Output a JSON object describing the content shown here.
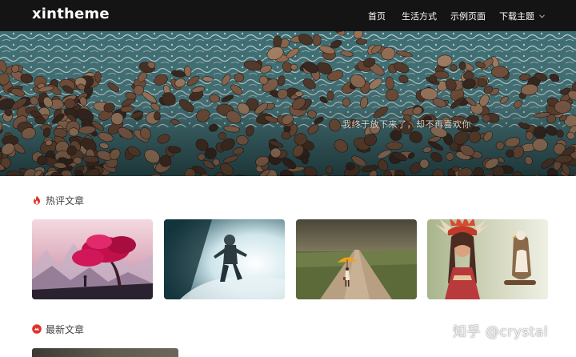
{
  "header": {
    "logo": "xintheme",
    "nav": [
      {
        "label": "首页"
      },
      {
        "label": "生活方式"
      },
      {
        "label": "示例页面"
      },
      {
        "label": "下载主题",
        "has_dropdown": true
      }
    ]
  },
  "hero": {
    "caption": "我终于放下来了，却不再喜欢你",
    "image": "aerial-rocky-shoreline"
  },
  "sections": {
    "hot": {
      "title": "热评文章",
      "icon": "flame-icon"
    },
    "latest": {
      "title": "最新文章",
      "icon": "badge-icon"
    }
  },
  "hot_posts": [
    {
      "image": "pink-tree-illustration"
    },
    {
      "image": "astronaut-in-fog"
    },
    {
      "image": "girl-with-umbrella-on-road"
    },
    {
      "image": "woman-in-headdress-with-eagle"
    }
  ],
  "watermark": "知乎 @crystal",
  "colors": {
    "topbar": "#141414",
    "accent": "#e0322b"
  }
}
